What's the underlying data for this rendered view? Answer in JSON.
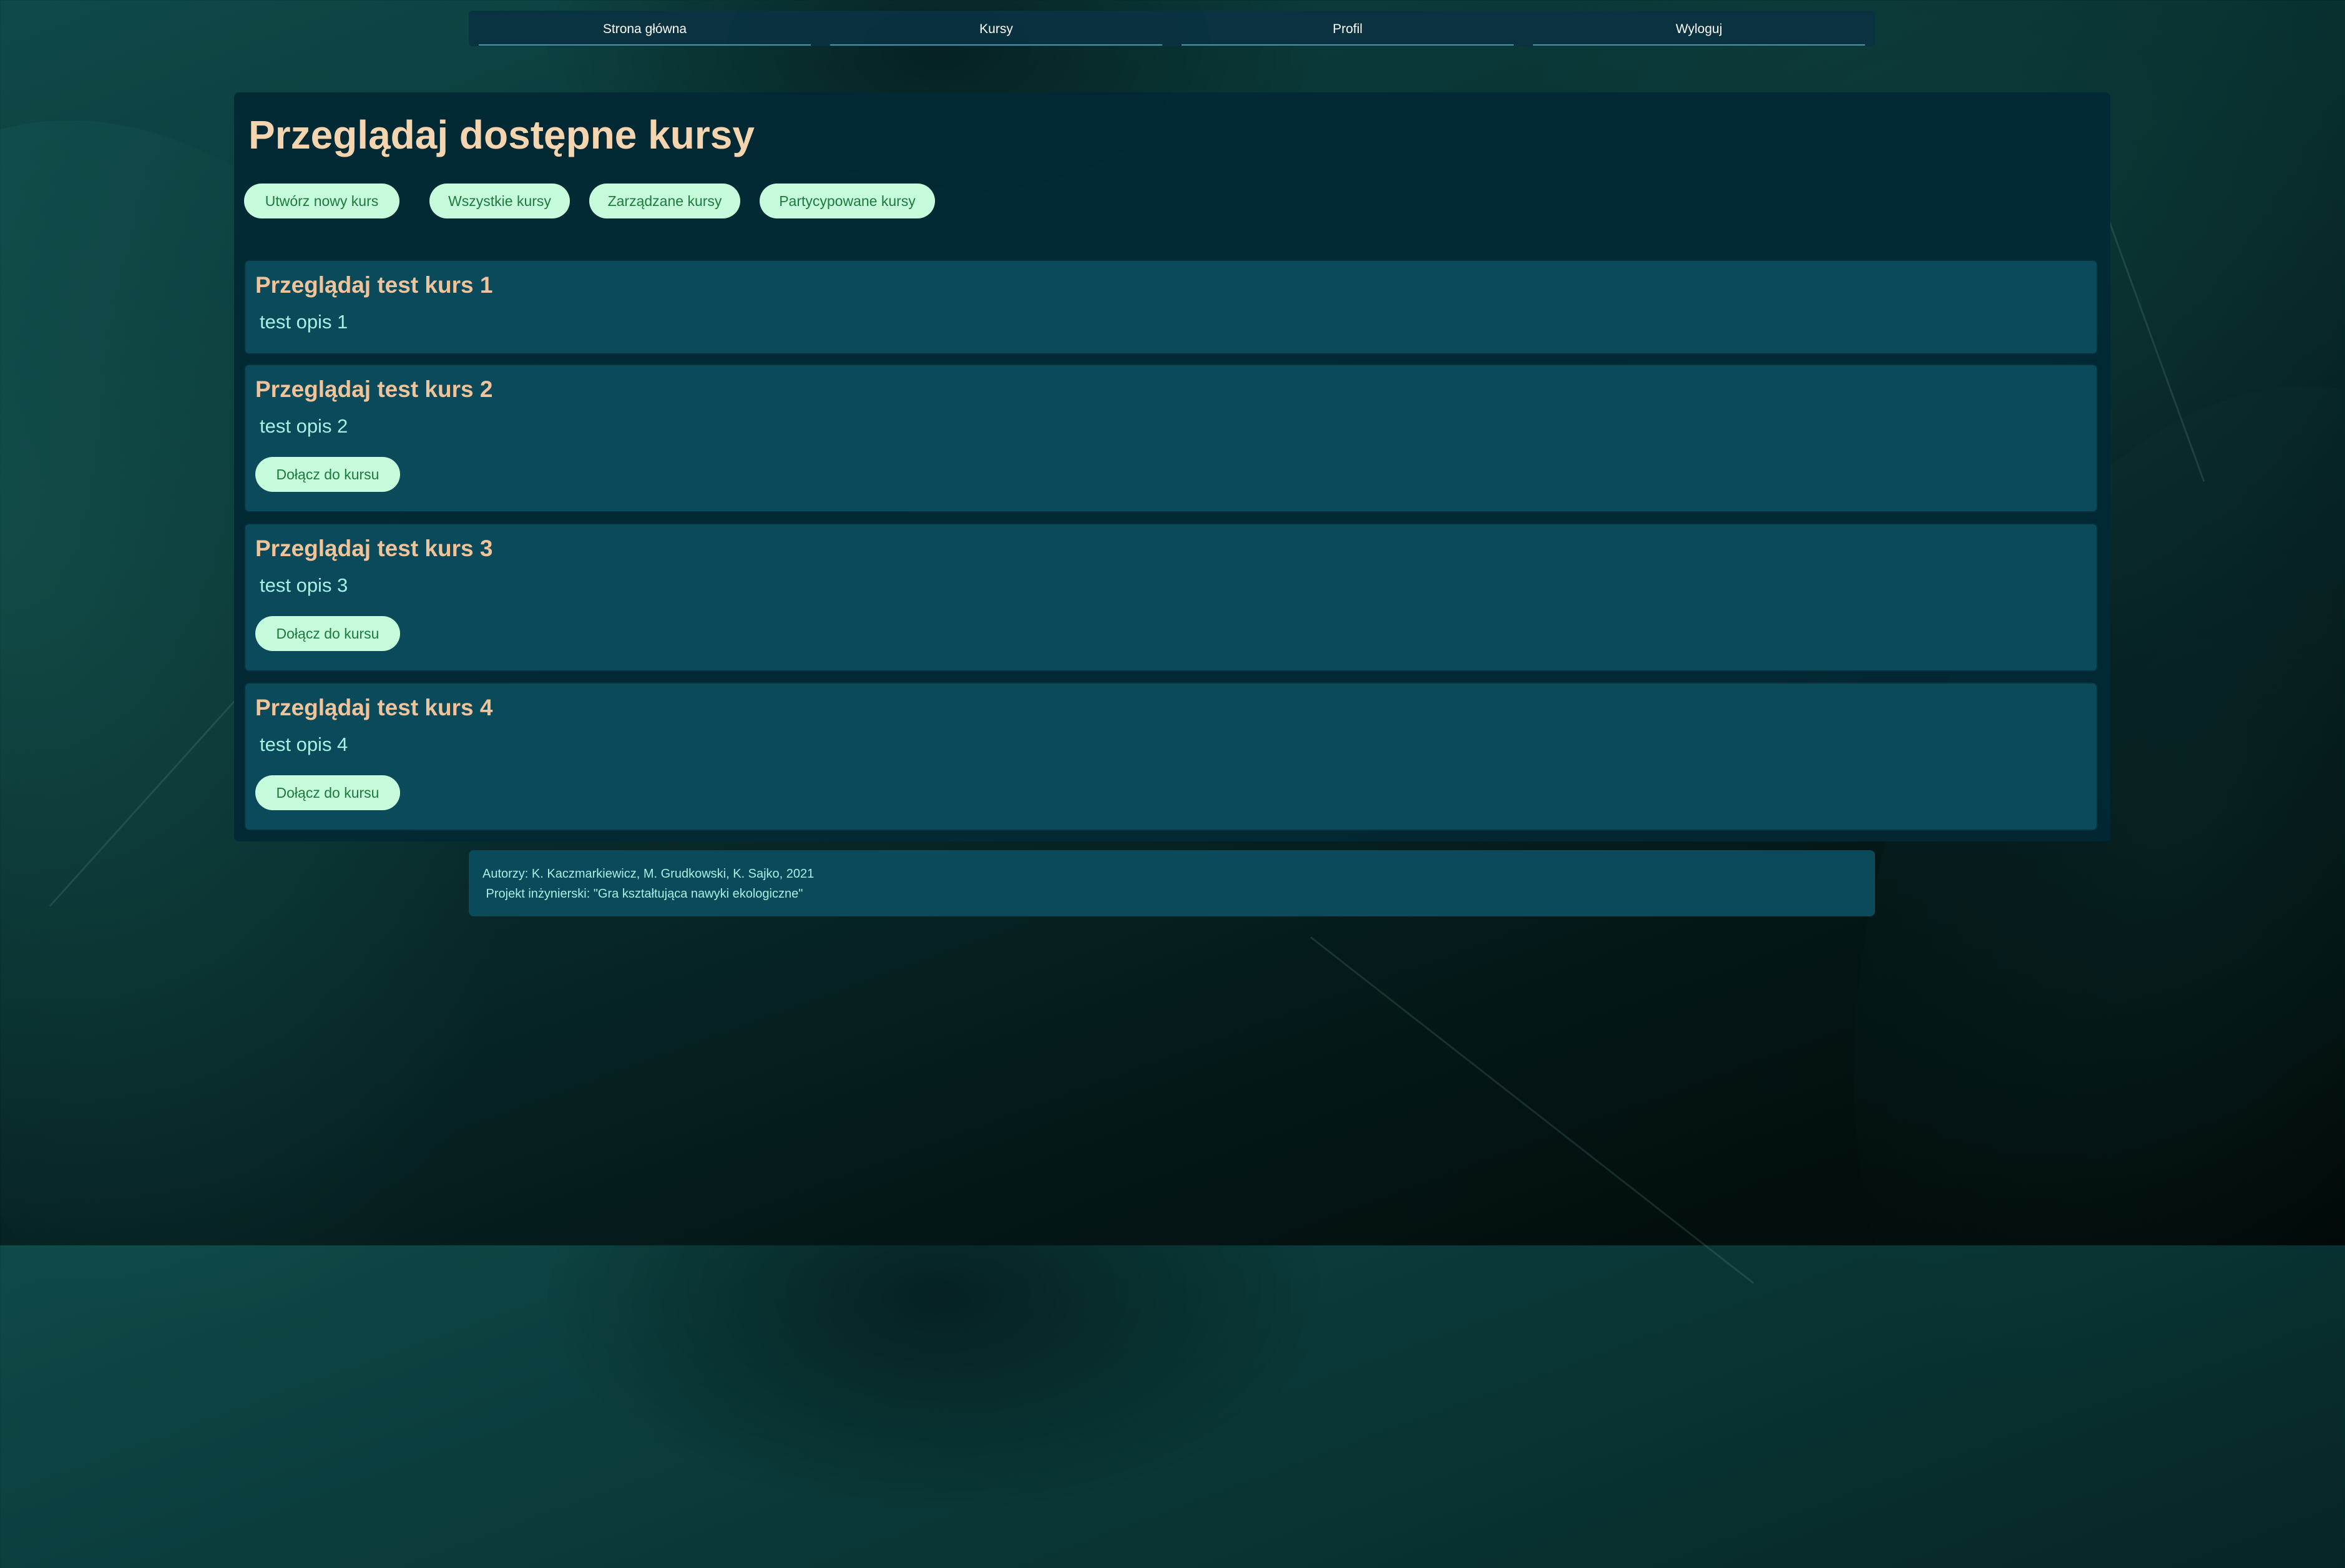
{
  "nav": {
    "items": [
      {
        "label": "Strona główna"
      },
      {
        "label": "Kursy"
      },
      {
        "label": "Profil"
      },
      {
        "label": "Wyloguj"
      }
    ]
  },
  "main": {
    "title": "Przeglądaj dostępne kursy",
    "actions": {
      "create": "Utwórz nowy kurs",
      "all": "Wszystkie kursy",
      "managed": "Zarządzane kursy",
      "participated": "Partycypowane kursy"
    },
    "courses": [
      {
        "title": "Przeglądaj test kurs 1",
        "description": "test opis 1"
      },
      {
        "title": "Przeglądaj test kurs 2",
        "description": "test opis 2",
        "join_label": "Dołącz do kursu"
      },
      {
        "title": "Przeglądaj test kurs 3",
        "description": "test opis 3",
        "join_label": "Dołącz do kursu"
      },
      {
        "title": "Przeglądaj test kurs 4",
        "description": "test opis 4",
        "join_label": "Dołącz do kursu"
      }
    ]
  },
  "footer": {
    "authors": "Autorzy: K. Kaczmarkiewicz, M. Grudkowski, K. Sajko, 2021",
    "project": " Projekt inżynierski: \"Gra kształtująca nawyki ekologiczne\""
  },
  "colors": {
    "title": "#f5d4b0",
    "course_title": "#f0c49a",
    "description": "#a6f0e4",
    "pill_bg": "#c6fbdb",
    "pill_text": "#1c7a3c",
    "card_bg": "#0b4a5b",
    "panel_bg": "#022834"
  }
}
